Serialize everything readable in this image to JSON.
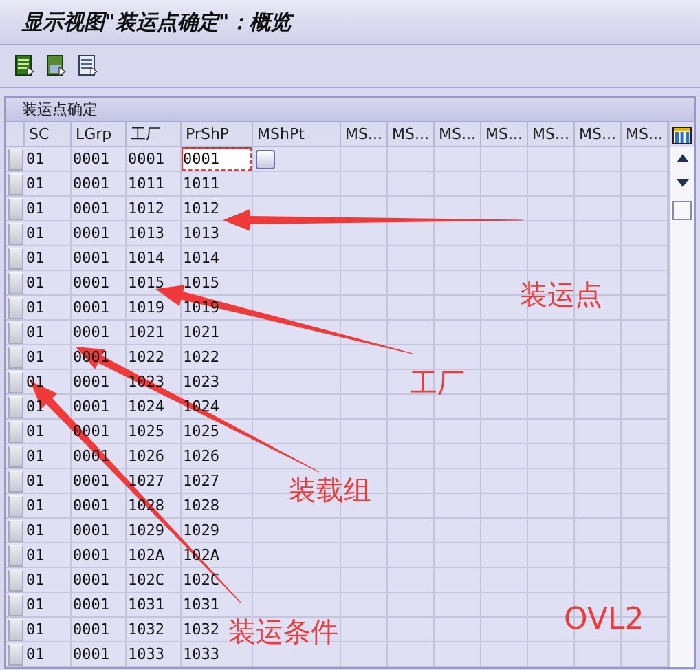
{
  "window": {
    "title": "显示视图\"装运点确定\"：概览"
  },
  "table": {
    "title": "装运点确定",
    "columns": [
      "SC",
      "LGrp",
      "工厂",
      "PrShP",
      "MShPt",
      "MS...",
      "MS...",
      "MS...",
      "MS...",
      "MS...",
      "MS...",
      "MS..."
    ],
    "rows": [
      {
        "cells": [
          "01",
          "0001",
          "0001",
          "0001"
        ],
        "focused": true
      },
      {
        "cells": [
          "01",
          "0001",
          "1011",
          "1011"
        ],
        "focused": false
      },
      {
        "cells": [
          "01",
          "0001",
          "1012",
          "1012"
        ],
        "focused": false
      },
      {
        "cells": [
          "01",
          "0001",
          "1013",
          "1013"
        ],
        "focused": false
      },
      {
        "cells": [
          "01",
          "0001",
          "1014",
          "1014"
        ],
        "focused": false
      },
      {
        "cells": [
          "01",
          "0001",
          "1015",
          "1015"
        ],
        "focused": false
      },
      {
        "cells": [
          "01",
          "0001",
          "1019",
          "1019"
        ],
        "focused": false
      },
      {
        "cells": [
          "01",
          "0001",
          "1021",
          "1021"
        ],
        "focused": false
      },
      {
        "cells": [
          "01",
          "0001",
          "1022",
          "1022"
        ],
        "focused": false
      },
      {
        "cells": [
          "01",
          "0001",
          "1023",
          "1023"
        ],
        "focused": false
      },
      {
        "cells": [
          "01",
          "0001",
          "1024",
          "1024"
        ],
        "focused": false
      },
      {
        "cells": [
          "01",
          "0001",
          "1025",
          "1025"
        ],
        "focused": false
      },
      {
        "cells": [
          "01",
          "0001",
          "1026",
          "1026"
        ],
        "focused": false
      },
      {
        "cells": [
          "01",
          "0001",
          "1027",
          "1027"
        ],
        "focused": false
      },
      {
        "cells": [
          "01",
          "0001",
          "1028",
          "1028"
        ],
        "focused": false
      },
      {
        "cells": [
          "01",
          "0001",
          "1029",
          "1029"
        ],
        "focused": false
      },
      {
        "cells": [
          "01",
          "0001",
          "102A",
          "102A"
        ],
        "focused": false
      },
      {
        "cells": [
          "01",
          "0001",
          "102C",
          "102C"
        ],
        "focused": false
      },
      {
        "cells": [
          "01",
          "0001",
          "1031",
          "1031"
        ],
        "focused": false
      },
      {
        "cells": [
          "01",
          "0001",
          "1032",
          "1032"
        ],
        "focused": false
      },
      {
        "cells": [
          "01",
          "0001",
          "1033",
          "1033"
        ],
        "focused": false
      }
    ]
  },
  "annotations": [
    {
      "text": "装运点"
    },
    {
      "text": "工厂"
    },
    {
      "text": "装载组"
    },
    {
      "text": "装运条件"
    }
  ],
  "note": "OVL2"
}
